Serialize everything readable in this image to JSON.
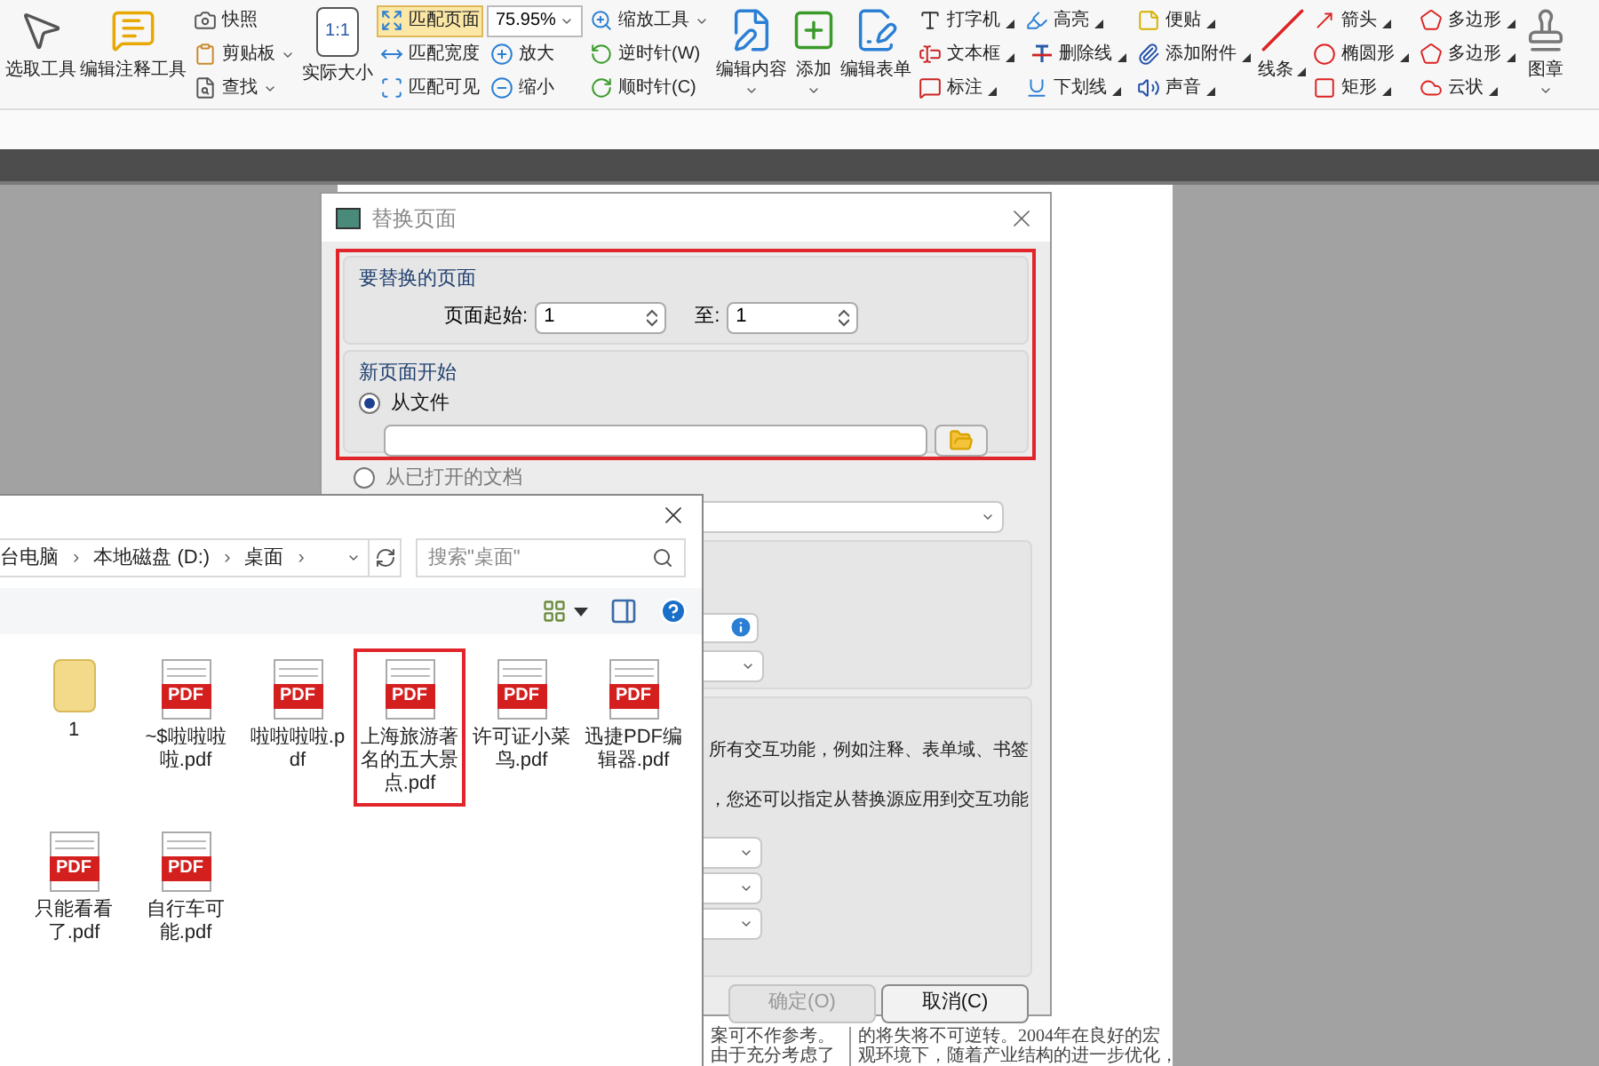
{
  "ribbon": {
    "columns": [
      {
        "kind": "large",
        "label": "选取工具"
      },
      {
        "kind": "large",
        "label": "编辑注释工具"
      },
      {
        "kind": "stack",
        "items": [
          {
            "kind": "button",
            "label": "快照"
          },
          {
            "kind": "button",
            "label": "剪贴板",
            "dropdown": true
          },
          {
            "kind": "button",
            "label": "查找",
            "dropdown": true
          }
        ]
      },
      {
        "kind": "large",
        "label": "实际大小",
        "icon_text": "1:1"
      },
      {
        "kind": "stack",
        "items": [
          {
            "kind": "button",
            "label": "匹配页面",
            "selected": true
          },
          {
            "kind": "button",
            "label": "匹配宽度",
            "selected": false
          },
          {
            "kind": "button",
            "label": "匹配可见",
            "selected": false
          }
        ]
      },
      {
        "kind": "stack",
        "items": [
          {
            "kind": "combo",
            "value": "75.95%"
          },
          {
            "kind": "button",
            "label": "放大"
          },
          {
            "kind": "button",
            "label": "缩小"
          }
        ]
      },
      {
        "kind": "stack",
        "items": [
          {
            "kind": "button",
            "label": "缩放工具",
            "dropdown": true
          },
          {
            "kind": "button",
            "label": "逆时针(W)"
          },
          {
            "kind": "button",
            "label": "顺时针(C)"
          }
        ]
      },
      {
        "kind": "large",
        "label": "编辑内容",
        "dropdown": true
      },
      {
        "kind": "large",
        "label": "添加",
        "dropdown": true
      },
      {
        "kind": "large",
        "label": "编辑表单"
      },
      {
        "kind": "stack",
        "items": [
          {
            "kind": "button",
            "label": "打字机",
            "more_options": true
          },
          {
            "kind": "button",
            "label": "文本框",
            "more_options": true
          },
          {
            "kind": "button",
            "label": "标注",
            "more_options": true
          }
        ]
      },
      {
        "kind": "stack",
        "items": [
          {
            "kind": "button",
            "label": "高亮",
            "more_options": true
          },
          {
            "kind": "button",
            "label": "删除线",
            "more_options": true
          },
          {
            "kind": "button",
            "label": "下划线",
            "more_options": true
          }
        ]
      },
      {
        "kind": "stack",
        "items": [
          {
            "kind": "button",
            "label": "便贴",
            "more_options": true
          },
          {
            "kind": "button",
            "label": "添加附件",
            "more_options": true
          },
          {
            "kind": "button",
            "label": "声音",
            "more_options": true
          }
        ]
      },
      {
        "kind": "large",
        "label": "线条",
        "more_options": true
      },
      {
        "kind": "stack",
        "items": [
          {
            "kind": "button",
            "label": "箭头",
            "more_options": true
          },
          {
            "kind": "button",
            "label": "椭圆形",
            "more_options": true
          },
          {
            "kind": "button",
            "label": "矩形",
            "more_options": true
          }
        ]
      },
      {
        "kind": "stack",
        "items": [
          {
            "kind": "button",
            "label": "多边形",
            "more_options": true
          },
          {
            "kind": "button",
            "label": "多边形",
            "more_options": true
          },
          {
            "kind": "button",
            "label": "云状",
            "more_options": true
          }
        ]
      },
      {
        "kind": "large",
        "label": "图章",
        "dropdown": true
      }
    ]
  },
  "replace_dialog": {
    "title": "替换页面",
    "highlighted": true,
    "pages_group": {
      "heading": "要替换的页面",
      "from_label": "页面起始:",
      "from_value": "1",
      "to_label": "至:",
      "to_value": "1"
    },
    "new_page_group": {
      "heading": "新页面开始",
      "options": [
        {
          "kind": "file",
          "label": "从文件",
          "selected": true
        },
        {
          "kind": "open_document",
          "label": "从已打开的文档",
          "selected": false
        }
      ]
    },
    "interactive_text": [
      "所有交互功能，例如注释、表单域、书签",
      "，您还可以指定从替换源应用到交互功能"
    ],
    "buttons": [
      {
        "label": "确定(O)",
        "disabled": true
      },
      {
        "label": "取消(C)",
        "disabled": false
      }
    ]
  },
  "document_text": {
    "column_1": [
      "案可不作参考。",
      "由于充分考虑了"
    ],
    "column_2": [
      "的将失将不可逆转。2004年在良好的宏",
      "观环境下，随着产业结构的进一步优化，"
    ]
  },
  "file_dialog": {
    "breadcrumb": [
      {
        "label": "台电脑",
        "separator": "›"
      },
      {
        "label": "本地磁盘 (D:)",
        "separator": "›"
      },
      {
        "label": "桌面",
        "separator": "›"
      }
    ],
    "search": {
      "placeholder": "搜索\"桌面\""
    },
    "files": [
      {
        "kind": "folder",
        "name": "1",
        "selected": false
      },
      {
        "kind": "pdf",
        "badge": "PDF",
        "name": "~$啦啦啦啦.pdf",
        "selected": false
      },
      {
        "kind": "pdf",
        "badge": "PDF",
        "name": "啦啦啦啦.pdf",
        "selected": false
      },
      {
        "kind": "pdf",
        "badge": "PDF",
        "name": "上海旅游著名的五大景点.pdf",
        "selected": true
      },
      {
        "kind": "pdf",
        "badge": "PDF",
        "name": "许可证小菜鸟.pdf",
        "selected": false
      },
      {
        "kind": "pdf",
        "badge": "PDF",
        "name": "迅捷PDF编辑器.pdf",
        "selected": false
      },
      {
        "kind": "pdf",
        "badge": "PDF",
        "name": "只能看看了.pdf",
        "selected": false
      },
      {
        "kind": "pdf",
        "badge": "PDF",
        "name": "自行车可能.pdf",
        "selected": false
      }
    ]
  }
}
